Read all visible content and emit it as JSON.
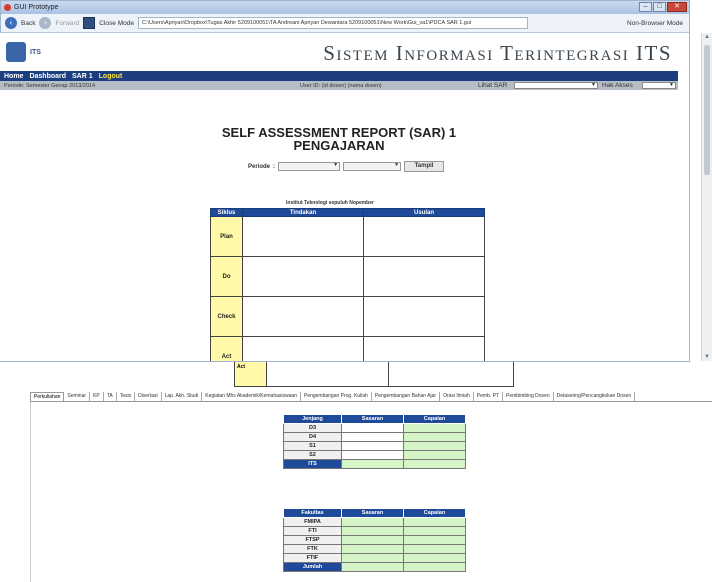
{
  "window": {
    "title": "GUI Prototype",
    "back_label": "Back",
    "forward_label": "Forward",
    "close_mode_label": "Close Mode",
    "address": "C:\\Users\\Apriyan\\Dropbox\\Tugas Akhir 5209100051\\TA Andreani Apriyan Dewantara 5209100051\\New Work\\Gui_va1\\PDCA SAR 1.gui",
    "non_browser_label": "Non-Browser Mode"
  },
  "site": {
    "logo_text": "ITS",
    "title": "Sistem Informasi Terintegrasi ITS"
  },
  "navbar": {
    "items": [
      "Home",
      "Dashboard",
      "SAR 1"
    ],
    "logout": "Logout"
  },
  "subbar": {
    "period": "Periode: Semester Genap 2013/2014",
    "user": "User ID: (id dosen) (nama dosen)",
    "lihat_sar": "Lihat SAR",
    "hak_akses": "Hak Akses"
  },
  "report": {
    "title_line1": "SELF ASSESSMENT REPORT (SAR) 1",
    "title_line2": "PENGAJARAN",
    "periode_label": "Periode",
    "tampil_label": "Tampil",
    "institution": "Institut Teknologi sepuluh Nopember",
    "columns": [
      "Siklus",
      "Tindakan",
      "Usulan"
    ],
    "cycles": [
      "Plan",
      "Do",
      "Check",
      "Act"
    ],
    "overlap_label": "Act"
  },
  "tabs": [
    "Perkuliahan",
    "Seminar",
    "KP",
    "TA",
    "Tesis",
    "Disertasi",
    "Lap. Akh. Studi",
    "Kegiatan Mhs Akademik/Kemahasiswaan",
    "Pengembangan Prog. Kuliah",
    "Pengembangan Bahan Ajar",
    "Orasi Ilmiah",
    "Pemb. PT",
    "Pembimbing Dosen",
    "Detasering/Pencangkokan Dosen"
  ],
  "jenjang_table": {
    "headers": [
      "Jenjang",
      "Sasaran",
      "Capaian"
    ],
    "rows": [
      "D3",
      "D4",
      "S1",
      "S2"
    ],
    "total": "ITS"
  },
  "fakultas_table": {
    "headers": [
      "Fakultas",
      "Sasaran",
      "Capaian"
    ],
    "rows": [
      "FMIPA",
      "FTI",
      "FTSP",
      "FTK",
      "FTIF"
    ],
    "total": "Jumlah"
  },
  "colors": {
    "nav_blue": "#1c3e80",
    "header_blue": "#1f4a9a",
    "cycle_yellow": "#fff9a8",
    "cell_green": "#d6f5c6",
    "logout_yellow": "#ffe23a"
  }
}
